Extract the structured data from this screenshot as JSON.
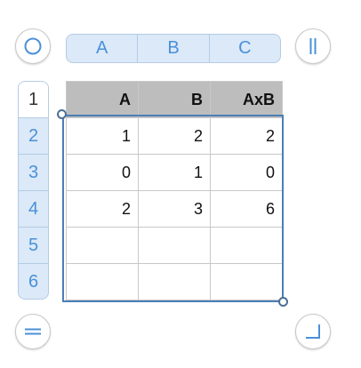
{
  "column_headers": [
    "A",
    "B",
    "C"
  ],
  "row_headers": [
    "1",
    "2",
    "3",
    "4",
    "5",
    "6"
  ],
  "active_row": "1",
  "table": {
    "header": [
      "A",
      "B",
      "AxB"
    ],
    "rows": [
      [
        "1",
        "2",
        "2"
      ],
      [
        "0",
        "1",
        "0"
      ],
      [
        "2",
        "3",
        "6"
      ],
      [
        "",
        "",
        ""
      ],
      [
        "",
        "",
        ""
      ]
    ]
  },
  "icons": {
    "top_left": "circle-icon",
    "top_right": "double-bar-icon",
    "bottom_left": "equals-icon",
    "bottom_right": "corner-icon"
  },
  "colors": {
    "accent": "#4a90d9",
    "header_fill": "#dbe9f8",
    "table_header_fill": "#bdbdbd",
    "selection": "#4a7fb5"
  }
}
